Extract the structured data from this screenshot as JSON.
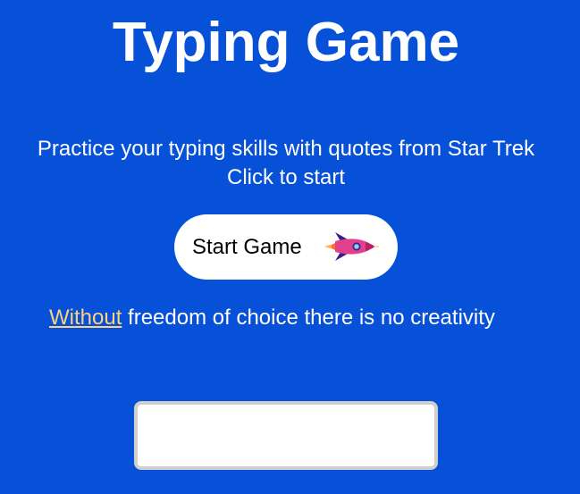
{
  "header": {
    "title": "Typing Game"
  },
  "intro": {
    "line1": "Practice your typing skills with quotes from Star Trek",
    "line2": "Click to start"
  },
  "start_button": {
    "label": "Start Game",
    "icon": "rocket-icon"
  },
  "quote": {
    "highlighted_word": "Without",
    "rest": " freedom of choice there is no creativity"
  },
  "typing_input": {
    "value": "",
    "placeholder": ""
  },
  "colors": {
    "background": "#0750d8",
    "text": "#ffffff",
    "highlight": "#ffd27a",
    "button_background": "#ffffff"
  }
}
